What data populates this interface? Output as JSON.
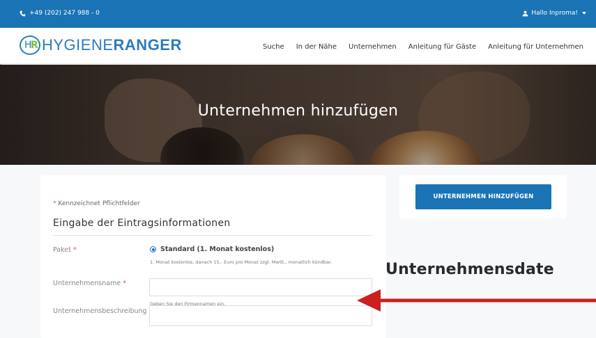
{
  "topbar": {
    "phone": "+49 (202) 247 988 - 0",
    "user": "Hallo Inproma!"
  },
  "logo": {
    "mark_left": "H",
    "mark_right": "R",
    "part1": "HYGIENE",
    "part2": "RANGER"
  },
  "nav": [
    "Suche",
    "In der Nähe",
    "Unternehmen",
    "Anleitung für Gäste",
    "Anleitung für Unternehmen"
  ],
  "hero": {
    "title": "Unternehmen hinzufügen"
  },
  "form": {
    "required_note": "Kennzeichnet Pflichtfelder",
    "required_star": "*",
    "section_title": "Eingabe der Eintragsinformationen",
    "paket": {
      "label": "Paket",
      "option": "Standard (1. Monat kostenlos)",
      "help": "1. Monat kostenlos, danach 15,- Euro pro Monat zzgl. MwSt., monatlich kündbar."
    },
    "name": {
      "label": "Unternehmensname",
      "value": "",
      "help": "Geben Sie den Firmennamen ein."
    },
    "description": {
      "label": "Unternehmensbeschreibung",
      "value": ""
    }
  },
  "sidebar": {
    "add_button": "UNTERNEHMEN HINZUFÜGEN"
  },
  "annotation": {
    "text": "Unternehmensdate"
  },
  "colors": {
    "brand_blue": "#1a73b5",
    "logo_green": "#7dc142",
    "required_red": "#d9534f",
    "arrow_red": "#cc1f1f"
  },
  "icons": {
    "phone": "phone-icon",
    "user": "user-icon"
  }
}
